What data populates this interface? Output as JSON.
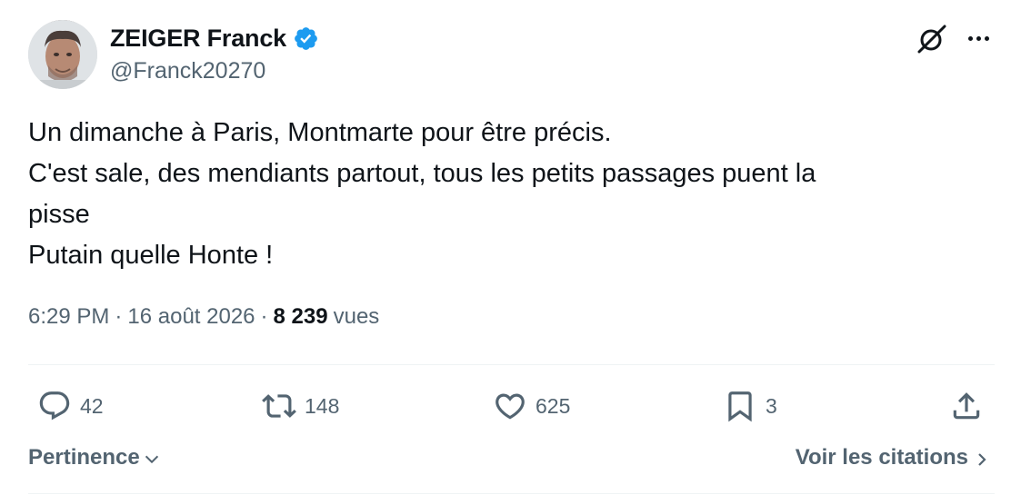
{
  "author": {
    "display_name": "ZEIGER Franck",
    "handle": "@Franck20270",
    "verified": true
  },
  "tweet": {
    "lines": [
      "Un dimanche à Paris, Montmarte pour être précis.",
      "C'est sale, des mendiants partout, tous les petits passages puent la",
      "pisse",
      "Putain quelle Honte !"
    ]
  },
  "meta": {
    "time": "6:29 PM",
    "date": "16 août 2026",
    "separator": "·",
    "views_count": "8 239",
    "views_label": "vues"
  },
  "actions": {
    "reply_count": "42",
    "retweet_count": "148",
    "like_count": "625",
    "bookmark_count": "3"
  },
  "footer": {
    "sort_label": "Pertinence",
    "quotes_label": "Voir les citations"
  },
  "colors": {
    "text_primary": "#0f1419",
    "text_secondary": "#536471",
    "verified_blue": "#1d9bf0",
    "divider": "#eff3f4"
  },
  "icons": [
    "verified-badge-icon",
    "grok-icon",
    "more-icon",
    "reply-icon",
    "retweet-icon",
    "like-icon",
    "bookmark-icon",
    "share-icon",
    "chevron-down-icon",
    "chevron-right-icon"
  ]
}
